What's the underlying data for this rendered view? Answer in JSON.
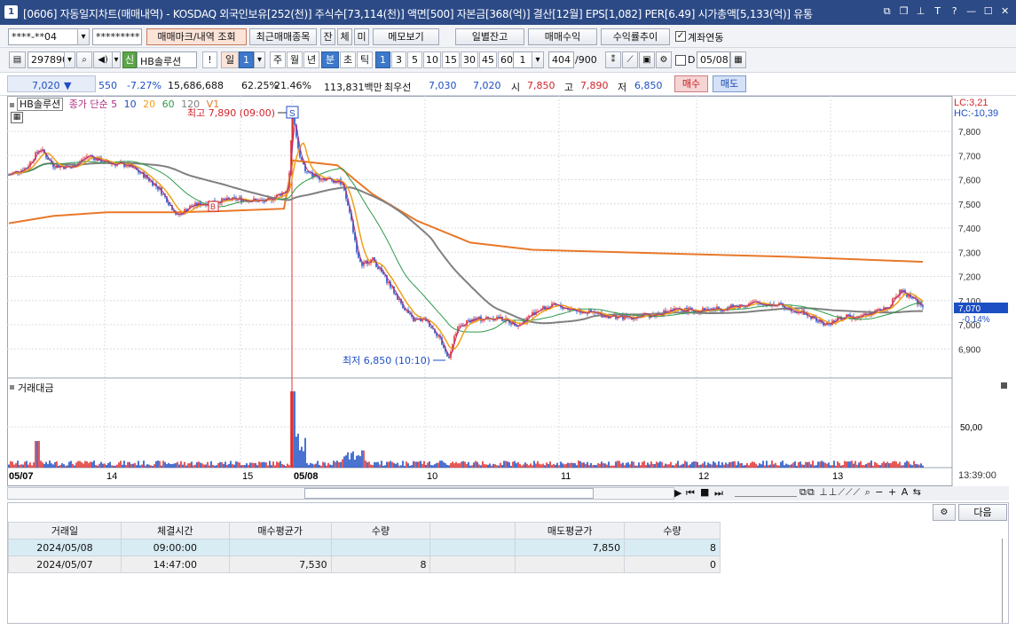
{
  "window": {
    "number": "1",
    "title": "[0606] 자동일지차트(매매내역) - KOSDAQ 외국인보유[252(천)] 주식수[73,114(천)] 액면[500] 자본금[368(억)] 결산[12월] EPS[1,082] PER[6.49] 시가총액[5,133(억)] 유통"
  },
  "toolbar1": {
    "account": "****-**04",
    "password": "*********",
    "mark_btn": "매매마크/내역 조회",
    "recent_btn": "최근매매종목",
    "tab_jan": "잔",
    "tab_che": "체",
    "tab_mi": "미",
    "memo_btn": "메모보기",
    "daily_btn": "일별잔고",
    "profit_btn": "매매수익",
    "return_btn": "수익률추이",
    "link_label": "계좌연동"
  },
  "toolbar2": {
    "code": "297890",
    "credit": "신",
    "stock_name": "HB솔루션",
    "alert": "!",
    "period_day": "일",
    "period_day_num": "1",
    "week": "주",
    "month": "월",
    "year": "년",
    "minute": "분",
    "second": "초",
    "tick": "틱",
    "intervals": [
      "1",
      "3",
      "5",
      "10",
      "15",
      "30",
      "45",
      "60"
    ],
    "interval_sel": "1",
    "count": "404",
    "count_total": "/900",
    "d_label": "D",
    "date": "05/08"
  },
  "quote": {
    "price": "7,020",
    "arrow": "▼",
    "change": "550",
    "change_pct": "-7.27%",
    "volume": "15,686,688",
    "ratio1": "62.25%",
    "ratio2": "21.46%",
    "amount": "113,831백만",
    "best_label": "최우선",
    "best_ask": "7,030",
    "best_bid": "7,020",
    "open_label": "시",
    "open": "7,850",
    "high_label": "고",
    "high": "7,890",
    "low_label": "저",
    "low": "6,850",
    "buy_btn": "매수",
    "sell_btn": "매도"
  },
  "chart": {
    "legend_name": "HB솔루션",
    "legend_ma": "종가 단순",
    "ma_periods": [
      "5",
      "10",
      "20",
      "60",
      "120"
    ],
    "legend_v": "V1",
    "lc": "LC:3,21",
    "hc": "HC:-10,39",
    "high_note": "최고 7,890 (09:00)",
    "low_note": "최저 6,850 (10:10)",
    "s_marker": "S",
    "b_marker": "B",
    "price_ticks": [
      "7,800",
      "7,700",
      "7,600",
      "7,500",
      "7,400",
      "7,300",
      "7,200",
      "7,100",
      "7,000",
      "6,900"
    ],
    "last_price": "7,070",
    "last_pct": "-0.14%",
    "vol_title": "거래대금",
    "vol_tick": "50,00",
    "x_labels": [
      "05/07",
      "14",
      "15",
      "05/08",
      "10",
      "11",
      "12",
      "13"
    ],
    "time_label": "13:39:00"
  },
  "lower": {
    "next_btn": "다음",
    "headers": [
      "거래일",
      "체결시간",
      "매수평균가",
      "수량",
      "",
      "매도평균가",
      "수량"
    ],
    "rows": [
      [
        "2024/05/08",
        "09:00:00",
        "",
        "",
        "",
        "7,850",
        "8"
      ],
      [
        "2024/05/07",
        "14:47:00",
        "7,530",
        "8",
        "",
        "",
        "0"
      ]
    ]
  }
}
